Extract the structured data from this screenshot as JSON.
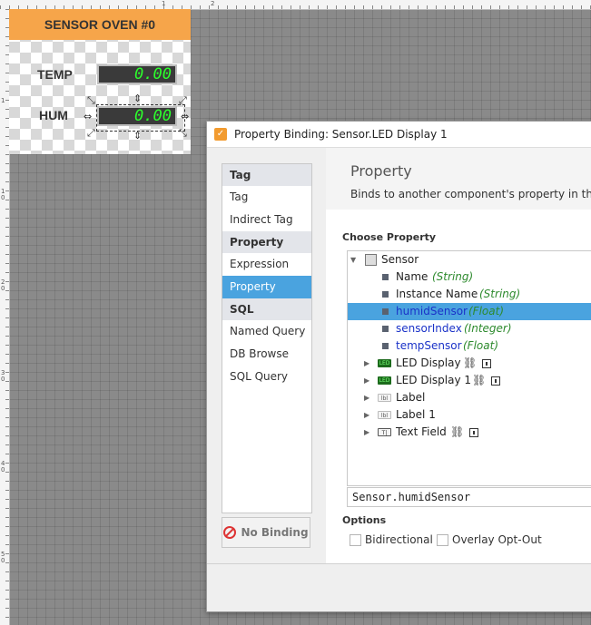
{
  "template": {
    "title": "SENSOR OVEN #0",
    "temp_label": "TEMP",
    "hum_label": "HUM",
    "temp_value": "0.00",
    "hum_value": "0.00",
    "header_color": "#f6a54a",
    "led_color": "#2cff2c"
  },
  "rulers": {
    "left_marks": [
      "1",
      "10",
      "20",
      "30",
      "40",
      "50",
      "60"
    ],
    "top_marks": [
      "1",
      "2"
    ]
  },
  "dialog": {
    "title": "Property Binding: Sensor.LED Display 1",
    "title_icon": "binding-app-icon",
    "nav": {
      "sections": [
        {
          "label": "Tag",
          "items": [
            "Tag",
            "Indirect Tag"
          ]
        },
        {
          "label": "Property",
          "items": [
            "Expression",
            "Property"
          ]
        },
        {
          "label": "SQL",
          "items": [
            "Named Query",
            "DB Browse",
            "SQL Query"
          ]
        }
      ],
      "active_item": "Property"
    },
    "no_binding_label": "No Binding",
    "panel_title": "Property",
    "panel_description": "Binds to another component's property in the sa",
    "choose_property_label": "Choose Property",
    "tree": {
      "root": "Sensor",
      "properties": [
        {
          "name": "Name",
          "type": "(String)",
          "style": "normal"
        },
        {
          "name": "Instance Name",
          "type": "(String)",
          "style": "normal"
        },
        {
          "name": "humidSensor",
          "type": "(Float)",
          "style": "selected"
        },
        {
          "name": "sensorIndex",
          "type": "(Integer)",
          "style": "custom"
        },
        {
          "name": "tempSensor",
          "type": "(Float)",
          "style": "custom"
        }
      ],
      "components": [
        {
          "name": "LED Display",
          "icon": "led-display-icon",
          "has_links": true
        },
        {
          "name": "LED Display 1",
          "icon": "led-display-icon",
          "has_links": true
        },
        {
          "name": "Label",
          "icon": "label-icon",
          "has_links": false
        },
        {
          "name": "Label 1",
          "icon": "label-icon",
          "has_links": false
        },
        {
          "name": "Text Field",
          "icon": "text-field-icon",
          "has_links": true
        }
      ]
    },
    "selected_path": "Sensor.humidSensor",
    "options_label": "Options",
    "options": [
      {
        "label": "Bidirectional",
        "checked": false
      },
      {
        "label": "Overlay Opt-Out",
        "checked": false
      }
    ],
    "accent_color": "#4aa3df"
  }
}
